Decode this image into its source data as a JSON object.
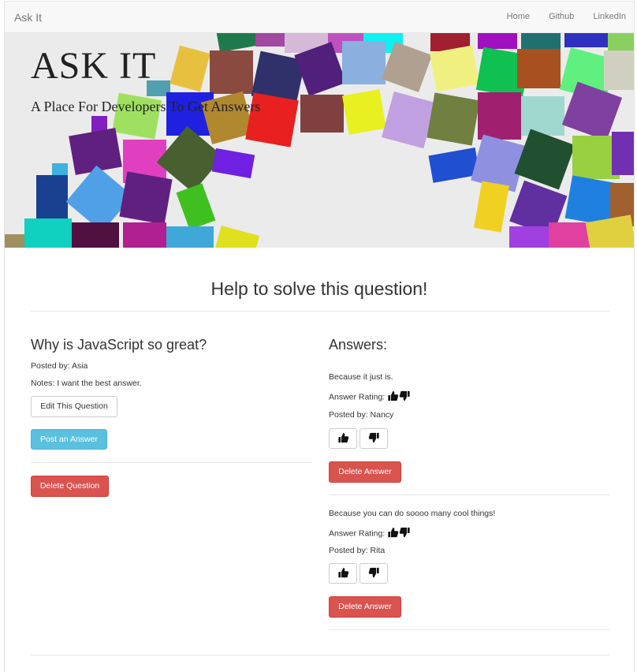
{
  "navbar": {
    "brand": "Ask It",
    "links": [
      "Home",
      "Github",
      "LinkedIn"
    ]
  },
  "hero": {
    "title": "ASK IT",
    "subtitle": "A Place For Developers To Get Answers"
  },
  "main": {
    "heading": "Help to solve this question!"
  },
  "question": {
    "title": "Why is JavaScript so great?",
    "posted_by": "Posted by: Asia",
    "notes": "Notes: I want the best answer.",
    "edit_label": "Edit This Question",
    "post_answer_label": "Post an Answer",
    "delete_label": "Delete Question"
  },
  "answers": {
    "heading": "Answers:",
    "items": [
      {
        "text": "Because it just is.",
        "rating_label": "Answer Rating:",
        "posted_by": "Posted by: Nancy",
        "delete_label": "Delete Answer"
      },
      {
        "text": "Because you can do soooo many cool things!",
        "rating_label": "Answer Rating:",
        "posted_by": "Posted by: Rita",
        "delete_label": "Delete Answer"
      }
    ]
  },
  "icons": {
    "thumbs_up": "thumbs-up-icon",
    "thumbs_down": "thumbs-down-icon"
  },
  "colors": {
    "info": "#5bc0de",
    "danger": "#d9534f",
    "navbar_bg": "#f8f8f8"
  }
}
